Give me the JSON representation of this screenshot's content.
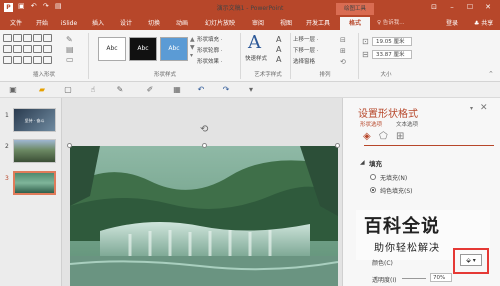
{
  "window": {
    "title": "演示文稿1 - PowerPoint",
    "contextual": "绘图工具",
    "controls": [
      "⊡",
      "–",
      "☐",
      "✕"
    ]
  },
  "tabs": [
    "文件",
    "开始",
    "iSlide",
    "插入",
    "设计",
    "切换",
    "动画",
    "幻灯片放映",
    "审阅",
    "视图",
    "开发工具",
    "格式"
  ],
  "header": {
    "search_placeholder": "♀ 告诉我...",
    "login": "登录",
    "share": "♣ 共享"
  },
  "ribbon": {
    "groups": {
      "insert_shapes": "插入形状",
      "shape_styles": "形状样式",
      "wordart_styles": "艺术字样式",
      "arrange": "排列",
      "size": "大小"
    },
    "style_presets": [
      "Abc",
      "Abc",
      "Abc"
    ],
    "shape_style_cmds": [
      "形状填充 ·",
      "形状轮廓 ·",
      "形状效果 ·"
    ],
    "quick_styles_label": "快速样式",
    "arrange_cmds": [
      "上移一层 ·",
      "下移一层 ·",
      "选择窗格"
    ],
    "size": {
      "height": "19.05 厘米",
      "width": "33.87 厘米"
    }
  },
  "slides": {
    "numbers": [
      "1",
      "2",
      "3"
    ],
    "active": "3",
    "slide1_text": "坚持 · 奋斗"
  },
  "panel": {
    "title": "设置形状格式",
    "tabs": [
      "形状选项",
      "文本选项"
    ],
    "section": "填充",
    "options": [
      "无填充(N)",
      "纯色填充(S)"
    ],
    "color_label": "颜色(C)",
    "transparency_label": "透明度(I)",
    "transparency_value": "70%"
  },
  "watermark": {
    "title": "百科全说",
    "subtitle": "助你轻松解决"
  },
  "colors": {
    "accent": "#b7472a",
    "highlight": "#e53935"
  }
}
